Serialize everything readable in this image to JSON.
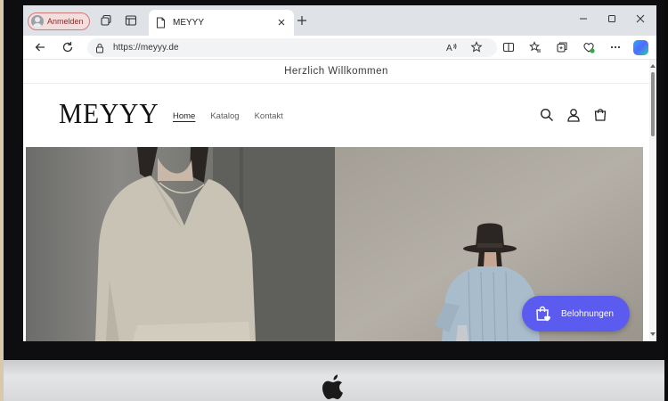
{
  "browser": {
    "profile_label": "Anmelden",
    "tab_title": "MEYYY",
    "url": "https://meyyy.de"
  },
  "site": {
    "announcement": "Herzlich Willkommen",
    "logo": "MEYYY",
    "nav": [
      {
        "label": "Home",
        "active": true
      },
      {
        "label": "Katalog",
        "active": false
      },
      {
        "label": "Kontakt",
        "active": false
      }
    ],
    "rewards_label": "Belohnungen"
  },
  "colors": {
    "rewards_button": "#5b5bef",
    "profile_border": "#d27a7a",
    "tabbar": "#dfe3e8"
  },
  "icons": [
    "tab-actions-icon",
    "vertical-tabs-icon",
    "page-icon",
    "close-icon",
    "plus-icon",
    "minimize-icon",
    "maximize-icon",
    "back-icon",
    "refresh-icon",
    "info-icon",
    "read-aloud-icon",
    "star-icon",
    "split-screen-icon",
    "favorites-icon",
    "collections-icon",
    "browser-essentials-icon",
    "more-icon",
    "copilot-icon",
    "search-icon",
    "account-icon",
    "cart-icon",
    "gift-bag-icon",
    "apple-logo"
  ]
}
